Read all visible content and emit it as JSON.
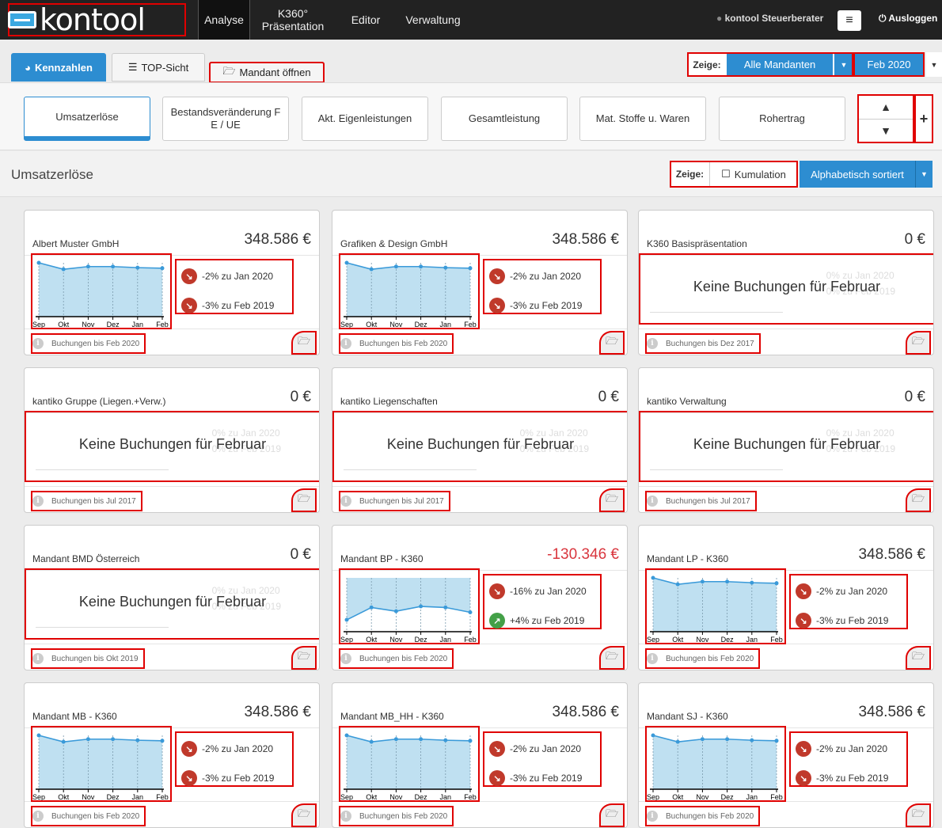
{
  "nav": {
    "logo": "kontool",
    "items": [
      "Analyse",
      "K360° Präsentation",
      "Editor",
      "Verwaltung"
    ],
    "user": "kontool Steuerberater",
    "menu_icon": "≡",
    "logout": "Ausloggen"
  },
  "tabs": {
    "kennzahlen": "Kennzahlen",
    "top_sicht": "TOP-Sicht",
    "mandant_oeffnen": "Mandant öffnen"
  },
  "filter": {
    "zeige_label": "Zeige:",
    "mandanten": "Alle Mandanten",
    "month": "Feb 2020"
  },
  "kennzahlen": [
    "Umsatzerlöse",
    "Bestandsveränderung F E / UE",
    "Akt. Eigenleistungen",
    "Gesamtleistung",
    "Mat. Stoffe u. Waren",
    "Rohertrag"
  ],
  "section": {
    "title": "Umsatzerlöse",
    "zeige_label": "Zeige:",
    "kumulation": "Kumulation",
    "sort": "Alphabetisch sortiert"
  },
  "chart_months": [
    "Sep",
    "Okt",
    "Nov",
    "Dez",
    "Jan",
    "Feb"
  ],
  "no_bookings_text": "Keine Buchungen für Februar",
  "ghost_stats": [
    "0% zu Jan 2020",
    "0% zu Feb 2019"
  ],
  "cards": [
    {
      "name": "Albert Muster GmbH",
      "value": "348.586 €",
      "has_chart": true,
      "series": [
        1.0,
        0.88,
        0.93,
        0.93,
        0.91,
        0.9
      ],
      "stat1": {
        "text": "-2% zu Jan 2020",
        "dir": "down"
      },
      "stat2": {
        "text": "-3% zu Feb 2019",
        "dir": "down"
      },
      "info": "Buchungen bis Feb 2020"
    },
    {
      "name": "Grafiken & Design GmbH",
      "value": "348.586 €",
      "has_chart": true,
      "series": [
        1.0,
        0.88,
        0.93,
        0.93,
        0.91,
        0.9
      ],
      "stat1": {
        "text": "-2% zu Jan 2020",
        "dir": "down"
      },
      "stat2": {
        "text": "-3% zu Feb 2019",
        "dir": "down"
      },
      "info": "Buchungen bis Feb 2020"
    },
    {
      "name": "K360 Basispräsentation",
      "value": "0 €",
      "has_chart": false,
      "info": "Buchungen bis Dez 2017"
    },
    {
      "name": "kantiko Gruppe (Liegen.+Verw.)",
      "value": "0 €",
      "has_chart": false,
      "info": "Buchungen bis Jul 2017"
    },
    {
      "name": "kantiko Liegenschaften",
      "value": "0 €",
      "has_chart": false,
      "info": "Buchungen bis Jul 2017"
    },
    {
      "name": "kantiko Verwaltung",
      "value": "0 €",
      "has_chart": false,
      "info": "Buchungen bis Jul 2017"
    },
    {
      "name": "Mandant BMD Österreich",
      "value": "0 €",
      "has_chart": false,
      "info": "Buchungen bis Okt 2019"
    },
    {
      "name": "Mandant BP - K360",
      "value": "-130.346 €",
      "negative": true,
      "has_chart": true,
      "fill_top": true,
      "series": [
        0.22,
        0.45,
        0.38,
        0.47,
        0.45,
        0.36
      ],
      "stat1": {
        "text": "-16% zu Jan 2020",
        "dir": "down"
      },
      "stat2": {
        "text": "+4% zu Feb 2019",
        "dir": "up"
      },
      "info": "Buchungen bis Feb 2020"
    },
    {
      "name": "Mandant LP - K360",
      "value": "348.586 €",
      "has_chart": true,
      "series": [
        1.0,
        0.88,
        0.93,
        0.93,
        0.91,
        0.9
      ],
      "stat1": {
        "text": "-2% zu Jan 2020",
        "dir": "down"
      },
      "stat2": {
        "text": "-3% zu Feb 2019",
        "dir": "down"
      },
      "info": "Buchungen bis Feb 2020"
    },
    {
      "name": "Mandant MB - K360",
      "value": "348.586 €",
      "has_chart": true,
      "series": [
        1.0,
        0.88,
        0.93,
        0.93,
        0.91,
        0.9
      ],
      "stat1": {
        "text": "-2% zu Jan 2020",
        "dir": "down"
      },
      "stat2": {
        "text": "-3% zu Feb 2019",
        "dir": "down"
      },
      "info": "Buchungen bis Feb 2020"
    },
    {
      "name": "Mandant MB_HH - K360",
      "value": "348.586 €",
      "has_chart": true,
      "series": [
        1.0,
        0.88,
        0.93,
        0.93,
        0.91,
        0.9
      ],
      "stat1": {
        "text": "-2% zu Jan 2020",
        "dir": "down"
      },
      "stat2": {
        "text": "-3% zu Feb 2019",
        "dir": "down"
      },
      "info": "Buchungen bis Feb 2020"
    },
    {
      "name": "Mandant SJ - K360",
      "value": "348.586 €",
      "has_chart": true,
      "series": [
        1.0,
        0.88,
        0.93,
        0.93,
        0.91,
        0.9
      ],
      "stat1": {
        "text": "-2% zu Jan 2020",
        "dir": "down"
      },
      "stat2": {
        "text": "-3% zu Feb 2019",
        "dir": "down"
      },
      "info": "Buchungen bis Feb 2020"
    }
  ],
  "colors": {
    "accent": "#2d8dd1",
    "nav_bg": "#222222",
    "highlight_box": "#e00000",
    "chart_line": "#3a9ad9",
    "chart_fill": "#bfe0f1",
    "stat_down": "#c0392b",
    "stat_up": "#43a047",
    "negative_value": "#d9363e"
  }
}
